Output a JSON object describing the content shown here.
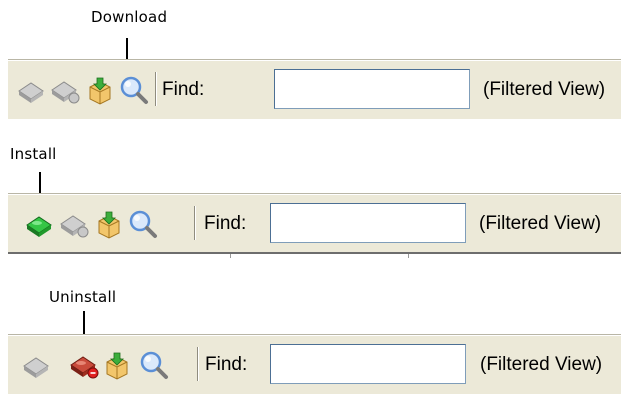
{
  "callouts": {
    "download": "Download",
    "install": "Install",
    "uninstall": "Uninstall"
  },
  "toolbars": [
    {
      "name": "download",
      "find_label": "Find:",
      "find_value": "",
      "filtered_view": "(Filtered View)",
      "icons": [
        "install-icon-disabled",
        "uninstall-icon-disabled",
        "download-icon",
        "search-icon"
      ]
    },
    {
      "name": "install",
      "find_label": "Find:",
      "find_value": "",
      "filtered_view": "(Filtered View)",
      "icons": [
        "install-icon-active",
        "uninstall-icon-disabled",
        "download-icon",
        "search-icon"
      ]
    },
    {
      "name": "uninstall",
      "find_label": "Find:",
      "find_value": "",
      "filtered_view": "(Filtered View)",
      "icons": [
        "install-icon-disabled",
        "uninstall-icon-active",
        "download-icon",
        "search-icon"
      ]
    }
  ],
  "colors": {
    "toolbar_bg": "#ece9d8",
    "install_active": "#1fae2f",
    "uninstall_active": "#c0392b",
    "disabled_gray": "#a9a9a9",
    "download_box": "#f2c66b",
    "search_lens": "#5b8fd6"
  }
}
